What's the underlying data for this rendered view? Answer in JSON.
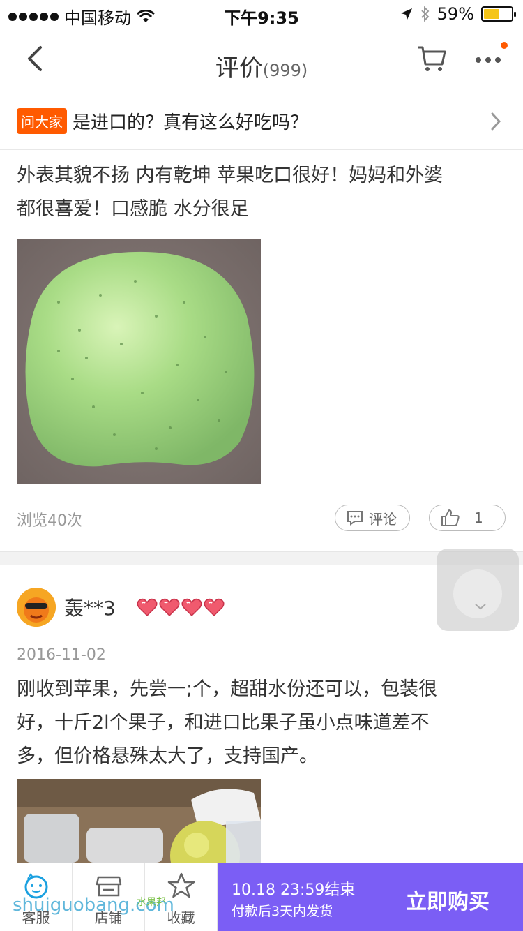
{
  "status_bar": {
    "carrier": "中国移动",
    "time": "下午9:35",
    "battery": "59%",
    "battery_level": 0.59
  },
  "nav": {
    "title": "评价",
    "count": "(999)"
  },
  "ask": {
    "tag": "问大家",
    "question": "是进口的？真有这么好吃吗？"
  },
  "review1": {
    "text_line1": "外表其貌不扬 内有乾坤 苹果吃口很好！妈妈和外婆",
    "text_line2": "都很喜爱！口感脆 水分很足",
    "views": "浏览40次",
    "comment_label": "评论",
    "like_count": "1"
  },
  "review2": {
    "username": "轰**3",
    "heart_count": 4,
    "date": "2016-11-02",
    "text_line1": "刚收到苹果，先尝一;个，超甜水份还可以，包装很",
    "text_line2": "好，十斤2l个果子，和进口比果子虽小点味道差不",
    "text_line3": "多，但价格悬殊太大了，支持国产。"
  },
  "bottom_bar": {
    "tab_service": "客服",
    "tab_store": "店铺",
    "tab_favorite": "收藏",
    "promo_line1": "10.18 23:59结束",
    "promo_line2": "付款后3天内发货",
    "buy_label": "立即购买"
  },
  "watermark": {
    "text": "shuiguobang.com",
    "text_cn": "水果邦"
  },
  "colors": {
    "accent_orange": "#ff5a00",
    "promo_purple": "#7b5ef5"
  }
}
